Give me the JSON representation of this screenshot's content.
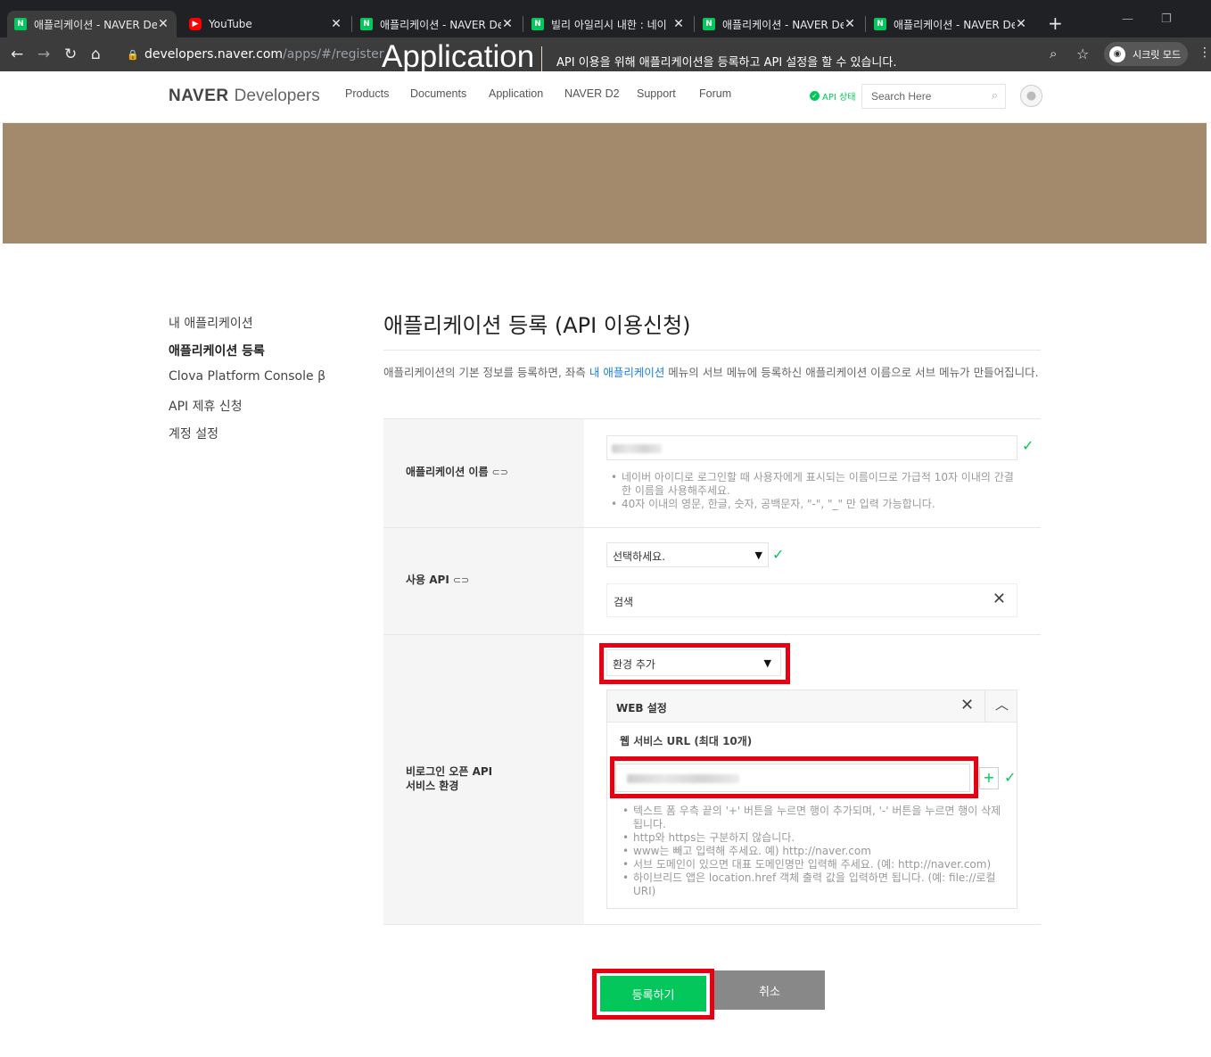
{
  "browser": {
    "tabs": [
      {
        "title": "애플리케이션 - NAVER De",
        "favicon": "naver-icon"
      },
      {
        "title": "YouTube",
        "favicon": "youtube-icon"
      },
      {
        "title": "애플리케이션 - NAVER De",
        "favicon": "naver-icon"
      },
      {
        "title": "빌리 아일리시 내한 : 네이",
        "favicon": "naver-icon"
      },
      {
        "title": "애플리케이션 - NAVER De",
        "favicon": "naver-icon"
      },
      {
        "title": "애플리케이션 - NAVER De",
        "favicon": "naver-icon"
      }
    ],
    "url_host": "developers.naver.com",
    "url_path": "/apps/#/register",
    "incognito_label": "시크릿 모드"
  },
  "site": {
    "logo_brand": "NAVER",
    "logo_suffix": "Developers",
    "nav": [
      "Products",
      "Documents",
      "Application",
      "NAVER D2",
      "Support",
      "Forum"
    ],
    "api_status": "API 상태",
    "search_placeholder": "Search Here"
  },
  "banner": {
    "title": "Application",
    "description": "API 이용을 위해 애플리케이션을 등록하고 API 설정을 할 수 있습니다."
  },
  "sidebar": {
    "items": [
      {
        "label": "내 애플리케이션",
        "active": false
      },
      {
        "label": "애플리케이션 등록",
        "active": true
      },
      {
        "label": "Clova Platform Console β",
        "active": false
      },
      {
        "label": "API 제휴 신청",
        "active": false
      },
      {
        "label": "계정 설정",
        "active": false
      }
    ]
  },
  "main": {
    "page_title": "애플리케이션 등록 (API 이용신청)",
    "intro_before": "애플리케이션의 기본 정보를 등록하면, 좌측 ",
    "intro_link": "내 애플리케이션",
    "intro_after": " 메뉴의 서브 메뉴에 등록하신 애플리케이션 이름으로 서브 메뉴가 만들어집니다.",
    "app_name": {
      "label": "애플리케이션 이름",
      "hints": [
        "네이버 아이디로 로그인할 때 사용자에게 표시되는 이름이므로 가급적 10자 이내의 간결한 이름을 사용해주세요.",
        "40자 이내의 영문, 한글, 숫자, 공백문자, \"-\", \"_\" 만 입력 가능합니다."
      ]
    },
    "api": {
      "label": "사용 API",
      "select_value": "선택하세요.",
      "selected_api": "검색"
    },
    "env": {
      "label_line1": "비로그인 오픈 API",
      "label_line2": "서비스 환경",
      "select_value": "환경 추가",
      "web_title": "WEB 설정",
      "url_label": "웹 서비스 URL (최대 10개)",
      "add_symbol": "+",
      "hints": [
        "텍스트 폼 우측 끝의 '+' 버튼을 누르면 행이 추가되며, '-' 버튼을 누르면 행이 삭제됩니다.",
        "http와 https는 구분하지 않습니다.",
        "www는 빼고 입력해 주세요. 예) http://naver.com",
        "서브 도메인이 있으면 대표 도메인명만 입력해 주세요. (예: http://naver.com)",
        "하이브리드 앱은 location.href 객체 출력 값을 입력하면 됩니다. (예: file://로컬URI)"
      ]
    },
    "buttons": {
      "register": "등록하기",
      "cancel": "취소"
    }
  },
  "colors": {
    "naver_green": "#03c75a",
    "banner_brown": "#a48a6d",
    "highlight_red": "#e60012",
    "cancel_gray": "#888888"
  }
}
